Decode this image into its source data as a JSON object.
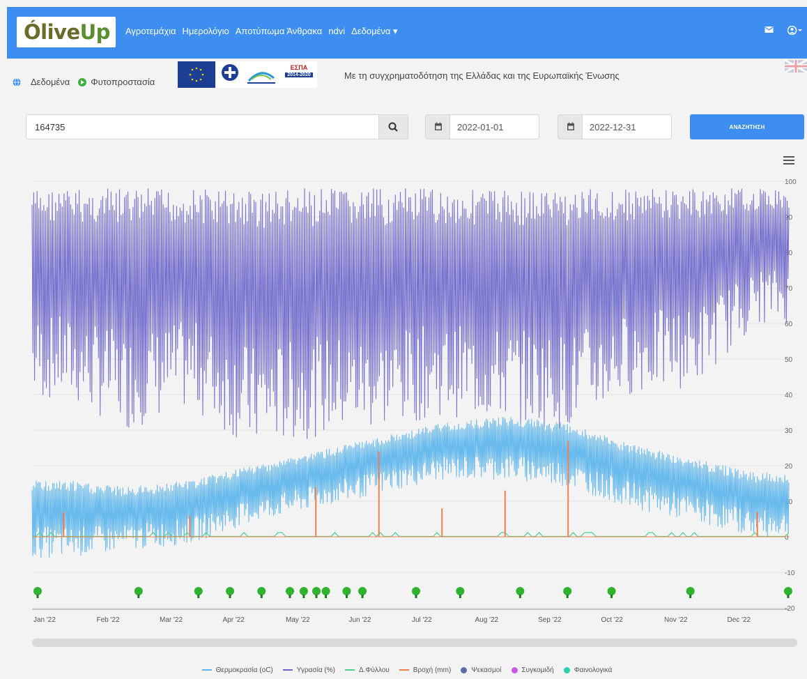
{
  "app": {
    "logo_text_a": "Ólive",
    "logo_text_b": "Up",
    "nav": [
      "Αγροτεμάχια",
      "Ημερολόγιο",
      "Αποτύπωμα Άνθρακα",
      "ndvi",
      "Δεδομένα ▾"
    ],
    "nav_right_icons": [
      "envelope-icon",
      "user-circle-icon"
    ]
  },
  "breadcrumb": {
    "item1": "Δεδομένα",
    "item2": "Φυτοπροστασία"
  },
  "funding": {
    "espa_label": "ΕΣΠΑ",
    "espa_years": "2014-2020",
    "text": "Με τη συγχρηματοδότηση της Ελλάδας και της Ευρωπαϊκής Ένωσης"
  },
  "search": {
    "field_value": "164735",
    "date_from": "2022-01-01",
    "date_to": "2022-12-31",
    "submit_label": "ΑΝΑΖΗΤΗΣΗ"
  },
  "chart_data": {
    "type": "line",
    "x_tick_labels": [
      "Jan '22",
      "Feb '22",
      "Mar '22",
      "Apr '22",
      "May '22",
      "Jun '22",
      "Jul '22",
      "Aug '22",
      "Sep '22",
      "Oct '22",
      "Nov '22",
      "Dec '22"
    ],
    "y_ticks": [
      100,
      90,
      80,
      70,
      60,
      50,
      40,
      30,
      20,
      10,
      0,
      -10,
      -20
    ],
    "ylim": [
      -20,
      100
    ],
    "grid": true,
    "legend_position": "bottom",
    "series": [
      {
        "name": "Θερμοκρασία (oC)",
        "color": "#5ab4ec",
        "monthly_min": [
          -6,
          -4,
          -2,
          4,
          8,
          12,
          16,
          16,
          14,
          8,
          4,
          0
        ],
        "monthly_max": [
          16,
          14,
          16,
          20,
          24,
          28,
          32,
          34,
          32,
          26,
          22,
          18
        ]
      },
      {
        "name": "Υγρασία (%)",
        "color": "#6a63c9",
        "monthly_min": [
          38,
          30,
          36,
          24,
          28,
          30,
          34,
          32,
          30,
          40,
          42,
          60
        ],
        "monthly_max": [
          98,
          98,
          98,
          98,
          98,
          98,
          98,
          98,
          98,
          98,
          98,
          98
        ]
      },
      {
        "name": "Δ.Φύλλου",
        "color": "#4cd38a",
        "values_desc": "near zero"
      },
      {
        "name": "Βροχή (mm)",
        "color": "#ef7f4f",
        "peaks": [
          {
            "month": "Jan",
            "value": 7
          },
          {
            "month": "Mar",
            "value": 6
          },
          {
            "month": "May",
            "value": 14
          },
          {
            "month": "Jun",
            "value": 24
          },
          {
            "month": "Jul",
            "value": 8
          },
          {
            "month": "Aug",
            "value": 13
          },
          {
            "month": "Sep",
            "value": 27
          },
          {
            "month": "Dec",
            "value": 7
          }
        ]
      },
      {
        "name": "Ψεκασμοί",
        "color": "#5a6aa8"
      },
      {
        "name": "Συγκομιδή",
        "color": "#cf57e8"
      },
      {
        "name": "Φαινολογικά",
        "color": "#2ccfb0"
      }
    ],
    "event_markers_months": [
      0.0,
      1.6,
      2.55,
      3.05,
      3.55,
      4.0,
      4.22,
      4.42,
      4.57,
      4.9,
      5.15,
      6.0,
      6.7,
      7.65,
      8.4,
      9.1,
      10.35,
      11.9
    ]
  },
  "colors": {
    "navbar": "#3d8ef0",
    "page": "#f3f3f3"
  }
}
